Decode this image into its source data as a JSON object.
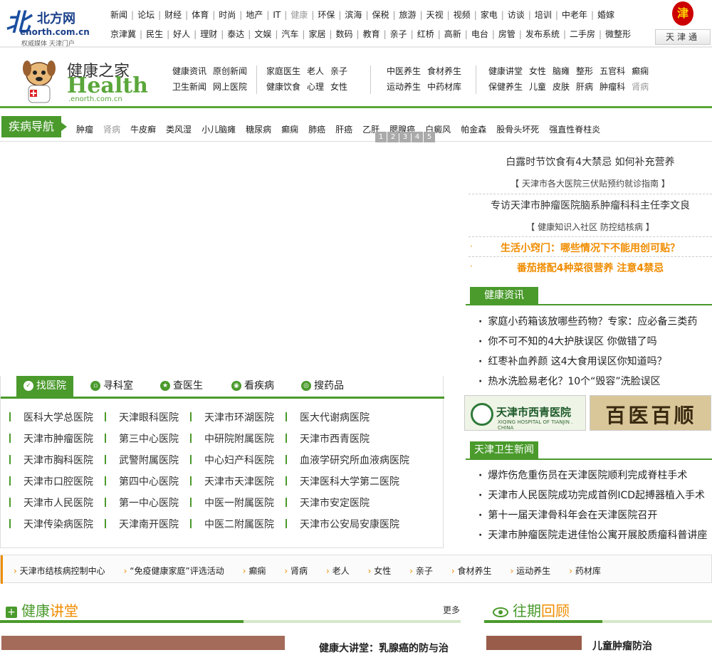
{
  "site": {
    "name_cn": "北方网",
    "domain": "enorth.com.cn",
    "slogan": "权威媒体 天津门户",
    "seal_char": "津",
    "tianjin_btn": "天津通"
  },
  "nav_row1": [
    "新闻",
    "论坛",
    "财经",
    "体育",
    "时尚",
    "地产",
    "IT",
    "健康",
    "环保",
    "滨海",
    "保税",
    "旅游",
    "天视",
    "视频",
    "家电",
    "访谈",
    "培训",
    "中老年",
    "婚嫁"
  ],
  "nav_row2": [
    "京津冀",
    "民生",
    "好人",
    "理财",
    "泰达",
    "文娱",
    "汽车",
    "家居",
    "数码",
    "教育",
    "亲子",
    "红桥",
    "高新",
    "电台",
    "房管",
    "发布系统",
    "二手房",
    "微整形"
  ],
  "health": {
    "title_cn": "健康之家",
    "title_en": "Health",
    "domain": ".enorth.com.cn",
    "group1": [
      [
        "健康资讯",
        "原创新闻"
      ],
      [
        "卫生新闻",
        "网上医院"
      ]
    ],
    "group2": [
      [
        "家庭医生",
        "老人",
        "亲子"
      ],
      [
        "健康饮食",
        "心理",
        "女性"
      ]
    ],
    "group3": [
      [
        "中医养生",
        "食材养生"
      ],
      [
        "运动养生",
        "中药材库"
      ]
    ],
    "group4": [
      [
        "健康讲堂",
        "女性",
        "脑瘫",
        "整形",
        "五官科",
        "癫痫"
      ],
      [
        "保健养生",
        "儿童",
        "皮肤",
        "肝病",
        "肿瘤科",
        "肾病"
      ]
    ]
  },
  "illness_nav": {
    "title": "疾病导航",
    "items": [
      "肿瘤",
      "肾病",
      "牛皮癣",
      "类风湿",
      "小儿脑瘫",
      "糖尿病",
      "癫痫",
      "肺癌",
      "肝癌",
      "乙肝",
      "腮腺癌",
      "白癜风",
      "帕金森",
      "股骨头坏死",
      "强直性脊柱炎"
    ],
    "pager": [
      "1",
      "2",
      "3",
      "4",
      "5"
    ]
  },
  "headlines": {
    "h1": "白露时节饮食有4大禁忌 如何补充营养",
    "s1": "【 天津市各大医院三伏贴预约就诊指南 】",
    "h2": "专访天津市肿瘤医院脑系肿瘤科科主任李文良",
    "s2": "【 健康知识入社区 防控结核病 】",
    "o1": "生活小窍门：哪些情况下不能用创可贴？",
    "o2": "番茄搭配4种菜很营养 注意4禁忌"
  },
  "health_news": {
    "title": "健康资讯",
    "items": [
      "家庭小药箱该放哪些药物？专家：应必备三类药",
      "你不可不知的4大护肤误区 你做错了吗",
      "红枣补血养颜 这4大食用误区你知道吗？",
      "热水洗脸易老化？10个“毁容”洗脸误区"
    ]
  },
  "ads": {
    "xiqing_cn": "天津市西青医院",
    "xiqing_en": "XIQING HOSPITAL OF TIANJIN . CHINA",
    "baiyi": "百医百顺"
  },
  "tj_news": {
    "title": "天津卫生新闻",
    "items": [
      "爆炸伤危重伤员在天津医院顺利完成脊柱手术",
      "天津市人民医院成功完成首例ICD起搏器植入手术",
      "第十一届天津骨科年会在天津医院召开",
      "天津市肿瘤医院走进佳怡公寓开展胶质瘤科普讲座"
    ]
  },
  "hospital_tabs": [
    "找医院",
    "寻科室",
    "查医生",
    "看疾病",
    "搜药品"
  ],
  "hospitals": [
    [
      "医科大学总医院",
      "天津眼科医院",
      "天津市环湖医院",
      "医大代谢病医院"
    ],
    [
      "天津市肿瘤医院",
      "第三中心医院",
      "中研院附属医院",
      "天津市西青医院"
    ],
    [
      "天津市胸科医院",
      "武警附属医院",
      "中心妇产科医院",
      "血液学研究所血液病医院"
    ],
    [
      "天津市口腔医院",
      "第四中心医院",
      "天津市天津医院",
      "天津医科大学第二医院"
    ],
    [
      "天津市人民医院",
      "第一中心医院",
      "中医一附属医院",
      "天津市安定医院"
    ],
    [
      "天津传染病医院",
      "天津南开医院",
      "中医二附属医院",
      "天津市公安局安康医院"
    ]
  ],
  "strip": [
    "天津市结核病控制中心",
    "“免疫健康家庭”评选活动",
    "癫痫",
    "肾病",
    "老人",
    "女性",
    "亲子",
    "食材养生",
    "运动养生",
    "药材库"
  ],
  "lecture": {
    "t1": "健康",
    "t2": "讲堂",
    "more": "更多",
    "snippet": "健康大讲堂：乳腺癌的防与治"
  },
  "review": {
    "t1": "往期",
    "t2": "回顾",
    "snippet": "儿童肿瘤防治"
  }
}
